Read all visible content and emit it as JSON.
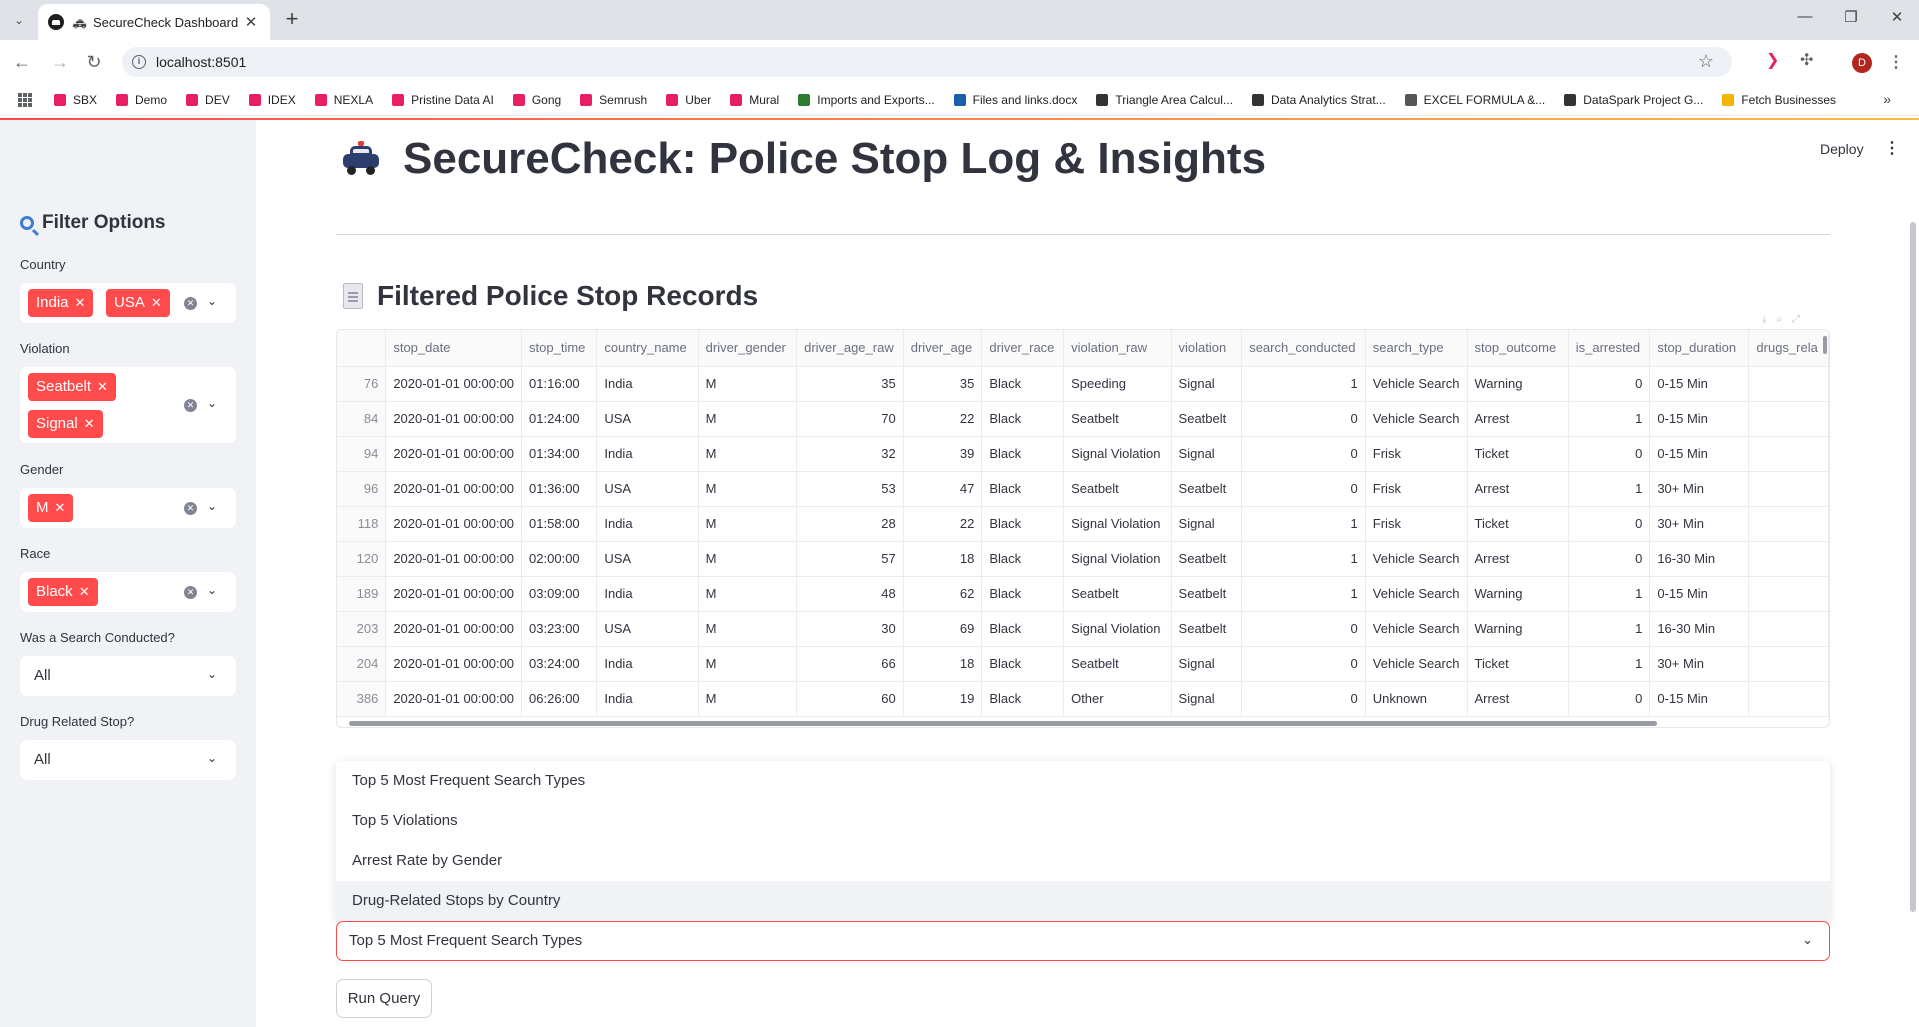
{
  "browser": {
    "tab_title": "SecureCheck Dashboard",
    "tab_emoji": "🚓",
    "url": "localhost:8501",
    "profile_initial": "D",
    "bookmarks": [
      {
        "label": "SBX",
        "color": "#e91e63"
      },
      {
        "label": "Demo",
        "color": "#e91e63"
      },
      {
        "label": "DEV",
        "color": "#e91e63"
      },
      {
        "label": "IDEX",
        "color": "#e91e63"
      },
      {
        "label": "NEXLA",
        "color": "#e91e63"
      },
      {
        "label": "Pristine Data AI",
        "color": "#e91e63"
      },
      {
        "label": "Gong",
        "color": "#e91e63"
      },
      {
        "label": "Semrush",
        "color": "#e91e63"
      },
      {
        "label": "Uber",
        "color": "#e91e63"
      },
      {
        "label": "Mural",
        "color": "#e91e63"
      },
      {
        "label": "Imports and Exports...",
        "color": "#2e7d32"
      },
      {
        "label": "Files and links.docx",
        "color": "#1a5dab"
      },
      {
        "label": "Triangle Area Calcul...",
        "color": "#333333"
      },
      {
        "label": "Data Analytics Strat...",
        "color": "#333333"
      },
      {
        "label": "EXCEL FORMULA &...",
        "color": "#555555"
      },
      {
        "label": "DataSpark Project G...",
        "color": "#333333"
      },
      {
        "label": "Fetch Businesses",
        "color": "#f4b400"
      }
    ]
  },
  "app": {
    "deploy_label": "Deploy",
    "title": "SecureCheck: Police Stop Log & Insights",
    "section_title": "Filtered Police Stop Records"
  },
  "sidebar": {
    "title": "Filter Options",
    "country_label": "Country",
    "country_chips": [
      "India",
      "USA"
    ],
    "violation_label": "Violation",
    "violation_chips": [
      "Seatbelt",
      "Signal"
    ],
    "gender_label": "Gender",
    "gender_chips": [
      "M"
    ],
    "race_label": "Race",
    "race_chips": [
      "Black"
    ],
    "search_label": "Was a Search Conducted?",
    "search_value": "All",
    "drug_label": "Drug Related Stop?",
    "drug_value": "All"
  },
  "table": {
    "columns": [
      "",
      "stop_date",
      "stop_time",
      "country_name",
      "driver_gender",
      "driver_age_raw",
      "driver_age",
      "driver_race",
      "violation_raw",
      "violation",
      "search_conducted",
      "search_type",
      "stop_outcome",
      "is_arrested",
      "stop_duration",
      "drugs_rela"
    ],
    "rows": [
      [
        "76",
        "2020-01-01 00:00:00",
        "01:16:00",
        "India",
        "M",
        "35",
        "35",
        "Black",
        "Speeding",
        "Signal",
        "1",
        "Vehicle Search",
        "Warning",
        "0",
        "0-15 Min",
        ""
      ],
      [
        "84",
        "2020-01-01 00:00:00",
        "01:24:00",
        "USA",
        "M",
        "70",
        "22",
        "Black",
        "Seatbelt",
        "Seatbelt",
        "0",
        "Vehicle Search",
        "Arrest",
        "1",
        "0-15 Min",
        ""
      ],
      [
        "94",
        "2020-01-01 00:00:00",
        "01:34:00",
        "India",
        "M",
        "32",
        "39",
        "Black",
        "Signal Violation",
        "Signal",
        "0",
        "Frisk",
        "Ticket",
        "0",
        "0-15 Min",
        ""
      ],
      [
        "96",
        "2020-01-01 00:00:00",
        "01:36:00",
        "USA",
        "M",
        "53",
        "47",
        "Black",
        "Seatbelt",
        "Seatbelt",
        "0",
        "Frisk",
        "Arrest",
        "1",
        "30+ Min",
        ""
      ],
      [
        "118",
        "2020-01-01 00:00:00",
        "01:58:00",
        "India",
        "M",
        "28",
        "22",
        "Black",
        "Signal Violation",
        "Signal",
        "1",
        "Frisk",
        "Ticket",
        "0",
        "30+ Min",
        ""
      ],
      [
        "120",
        "2020-01-01 00:00:00",
        "02:00:00",
        "USA",
        "M",
        "57",
        "18",
        "Black",
        "Signal Violation",
        "Seatbelt",
        "1",
        "Vehicle Search",
        "Arrest",
        "0",
        "16-30 Min",
        ""
      ],
      [
        "189",
        "2020-01-01 00:00:00",
        "03:09:00",
        "India",
        "M",
        "48",
        "62",
        "Black",
        "Seatbelt",
        "Seatbelt",
        "1",
        "Vehicle Search",
        "Warning",
        "1",
        "0-15 Min",
        ""
      ],
      [
        "203",
        "2020-01-01 00:00:00",
        "03:23:00",
        "USA",
        "M",
        "30",
        "69",
        "Black",
        "Signal Violation",
        "Seatbelt",
        "0",
        "Vehicle Search",
        "Warning",
        "1",
        "16-30 Min",
        ""
      ],
      [
        "204",
        "2020-01-01 00:00:00",
        "03:24:00",
        "India",
        "M",
        "66",
        "18",
        "Black",
        "Seatbelt",
        "Signal",
        "0",
        "Vehicle Search",
        "Ticket",
        "1",
        "30+ Min",
        ""
      ],
      [
        "386",
        "2020-01-01 00:00:00",
        "06:26:00",
        "India",
        "M",
        "60",
        "19",
        "Black",
        "Other",
        "Signal",
        "0",
        "Unknown",
        "Arrest",
        "0",
        "0-15 Min",
        ""
      ]
    ]
  },
  "query": {
    "options": [
      "Top 5 Most Frequent Search Types",
      "Top 5 Violations",
      "Arrest Rate by Gender",
      "Drug-Related Stops by Country"
    ],
    "selected": "Top 5 Most Frequent Search Types",
    "run_label": "Run Query"
  },
  "colors": {
    "accent": "#ff4b4b",
    "sidebar_bg": "#f0f2f6",
    "text": "#31333f"
  }
}
